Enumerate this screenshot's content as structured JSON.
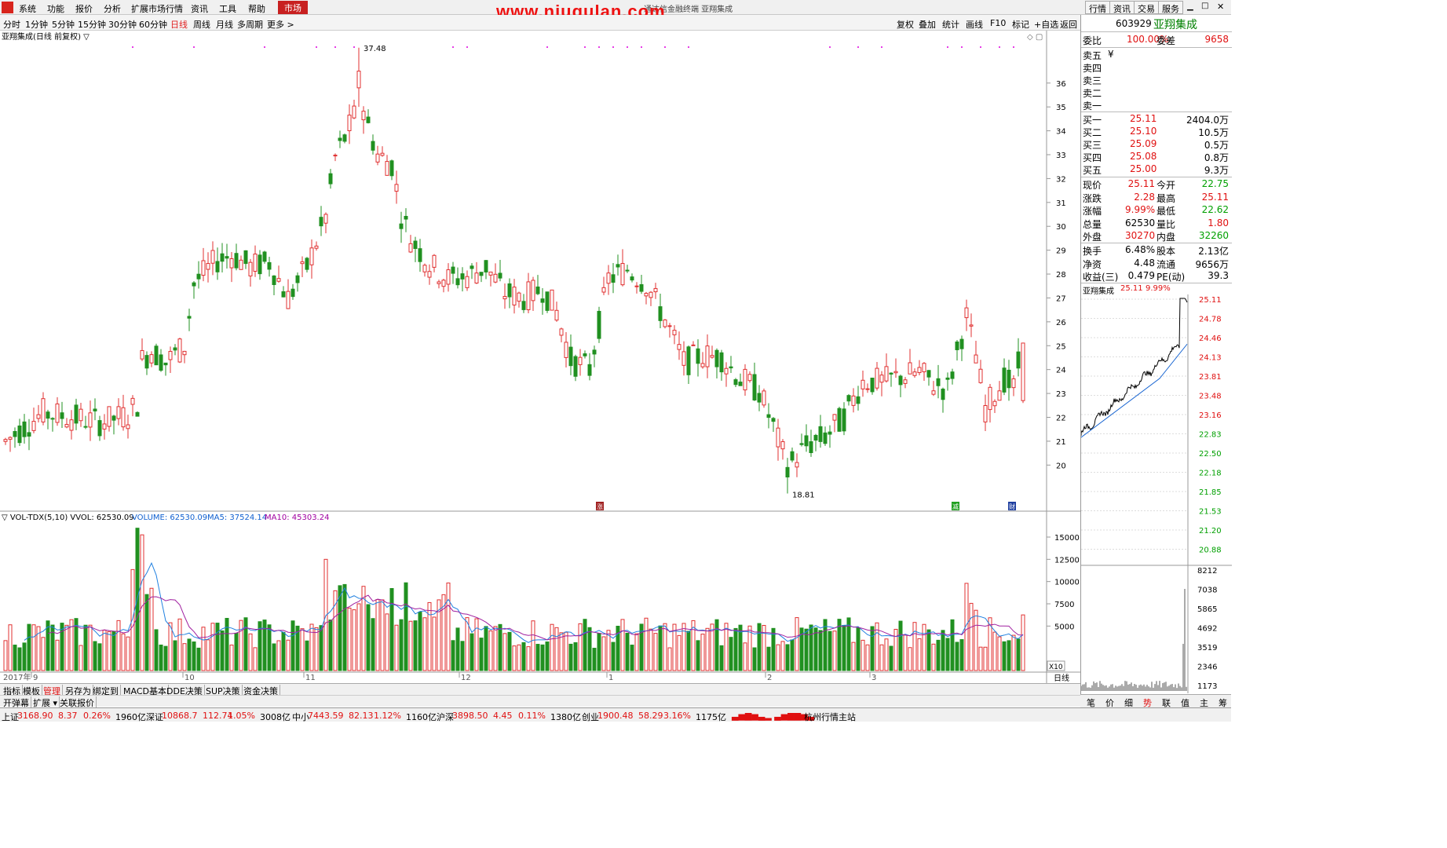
{
  "menu": {
    "items": [
      "系统",
      "功能",
      "报价",
      "分析",
      "扩展市场行情",
      "资讯",
      "工具",
      "帮助"
    ],
    "market": "市场",
    "right": [
      "行情",
      "资讯",
      "交易",
      "服务"
    ]
  },
  "watermark": "www.niugulan.com",
  "watermark_sub": "通达信金融终端 亚翔集成",
  "periods": {
    "items": [
      "分时",
      "1分钟",
      "5分钟",
      "15分钟",
      "30分钟",
      "60分钟",
      "日线",
      "周线",
      "月线",
      "多周期",
      "更多 >"
    ],
    "selected": "日线"
  },
  "toolbar": [
    "复权",
    "叠加",
    "统计",
    "画线",
    "F10",
    "标记",
    "+自选",
    "返回"
  ],
  "chart": {
    "title": "亚翔集成(日线 前复权) ▽",
    "vol_title": "▽ VOL-TDX(5,10) VVOL: 62530.09",
    "vol_legend": {
      "volume": "VOLUME: 62530.09",
      "ma5": "MA5: 37524.14",
      "ma10": "MA10: 45303.24"
    },
    "high_label": "37.48",
    "low_label": "18.81",
    "markers": [
      "涨",
      "减",
      "财"
    ],
    "x10": "X10",
    "period_corner": "日线"
  },
  "chart_data": {
    "type": "candlestick",
    "price_ticks": [
      36.0,
      35.0,
      34.0,
      33.0,
      32.0,
      31.0,
      30.0,
      29.0,
      28.0,
      27.0,
      26.0,
      25.0,
      24.0,
      23.0,
      22.0,
      21.0,
      20.0
    ],
    "price_ylim": [
      18.3,
      37.9
    ],
    "vol_ticks": [
      15000,
      12500,
      10000,
      7500,
      5000
    ],
    "vol_ylim": [
      0,
      16500
    ],
    "x_labels": [
      "2017年",
      "9",
      "10",
      "11",
      "12",
      "1",
      "2",
      "3"
    ],
    "highest": 37.48,
    "lowest": 18.81,
    "last_volume": 62530.09,
    "ma5": 37524.14,
    "ma10": 45303.24
  },
  "quote": {
    "code": "603929",
    "name": "亚翔集成",
    "weibi": {
      "label": "委比",
      "value": "100.00%",
      "label2": "委差",
      "value2": "9658"
    },
    "sell": [
      {
        "label": "卖五",
        "value": "¥"
      },
      {
        "label": "卖四",
        "value": ""
      },
      {
        "label": "卖三",
        "value": ""
      },
      {
        "label": "卖二",
        "value": ""
      },
      {
        "label": "卖一",
        "value": ""
      }
    ],
    "buy": [
      {
        "label": "买一",
        "price": "25.11",
        "vol": "2404.0万"
      },
      {
        "label": "买二",
        "price": "25.10",
        "vol": "10.5万"
      },
      {
        "label": "买三",
        "price": "25.09",
        "vol": "0.5万"
      },
      {
        "label": "买四",
        "price": "25.08",
        "vol": "0.8万"
      },
      {
        "label": "买五",
        "price": "25.00",
        "vol": "9.3万"
      }
    ],
    "stats": [
      {
        "l1": "现价",
        "v1": "25.11",
        "l2": "今开",
        "v2": "22.75",
        "c1": "red",
        "c2": "green"
      },
      {
        "l1": "涨跌",
        "v1": "2.28",
        "l2": "最高",
        "v2": "25.11",
        "c1": "red",
        "c2": "red"
      },
      {
        "l1": "涨幅",
        "v1": "9.99%",
        "l2": "最低",
        "v2": "22.62",
        "c1": "red",
        "c2": "green"
      },
      {
        "l1": "总量",
        "v1": "62530",
        "l2": "量比",
        "v2": "1.80",
        "c1": "black",
        "c2": "red"
      },
      {
        "l1": "外盘",
        "v1": "30270",
        "l2": "内盘",
        "v2": "32260",
        "c1": "red",
        "c2": "green"
      }
    ],
    "stats2": [
      {
        "l1": "换手",
        "v1": "6.48%",
        "l2": "股本",
        "v2": "2.13亿"
      },
      {
        "l1": "净资",
        "v1": "4.48",
        "l2": "流通",
        "v2": "9656万"
      },
      {
        "l1": "收益(三)",
        "v1": "0.479",
        "l2": "PE(动)",
        "v2": "39.3"
      }
    ]
  },
  "mini": {
    "title": "亚翔集成",
    "price": "25.11",
    "pct": "9.99%",
    "ticks": [
      "25.11",
      "24.78",
      "24.46",
      "24.13",
      "23.81",
      "23.48",
      "23.16",
      "22.83",
      "22.50",
      "22.18",
      "21.85",
      "21.53",
      "21.20",
      "20.88"
    ],
    "vol_ticks": [
      "8212",
      "7038",
      "5865",
      "4692",
      "3519",
      "2346",
      "1173"
    ]
  },
  "bottom_tabs": [
    "指标",
    "模板",
    "管理",
    "另存为",
    "绑定到",
    "MACD基本",
    "DDE决策",
    "SUP决策",
    "资金决策"
  ],
  "bottom_tabs2": [
    "开弹幕",
    "扩展 ▾",
    "关联报价"
  ],
  "side_tabs": [
    "笔",
    "价",
    "细",
    "势",
    "联",
    "值",
    "主",
    "筹"
  ],
  "status": [
    {
      "name": "上证",
      "price": "3168.90",
      "chg": "8.37",
      "pct": "0.26%",
      "amt": "1960亿"
    },
    {
      "name": "深证",
      "price": "10868.7",
      "chg": "112.74",
      "pct": "1.05%",
      "amt": "3008亿"
    },
    {
      "name": "中小",
      "price": "7443.59",
      "chg": "82.13",
      "pct": "1.12%",
      "amt": "1160亿"
    },
    {
      "name": "沪深",
      "price": "3898.50",
      "chg": "4.45",
      "pct": "0.11%",
      "amt": "1380亿"
    },
    {
      "name": "创业",
      "price": "1900.48",
      "chg": "58.29",
      "pct": "3.16%",
      "amt": "1175亿"
    }
  ],
  "status_right": "杭州行情主站"
}
